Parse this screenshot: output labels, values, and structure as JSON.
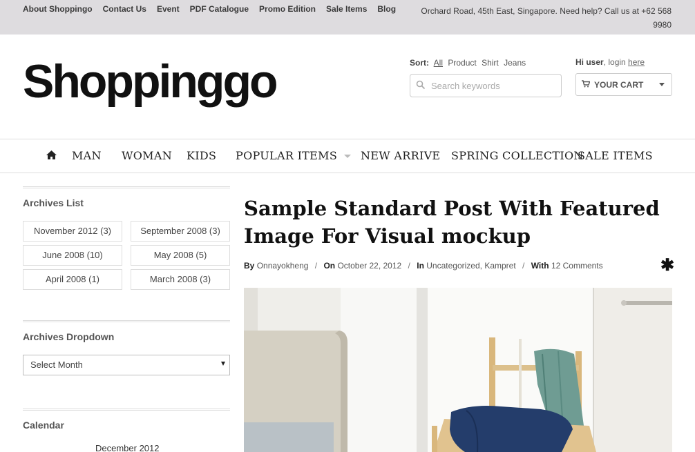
{
  "topbar": {
    "links": [
      "About Shoppingo",
      "Contact Us",
      "Event",
      "PDF Catalogue",
      "Promo Edition",
      "Sale Items",
      "Blog"
    ],
    "info": "Orchard Road, 45th East, Singapore. Need help? Call us at +62 568 9980"
  },
  "header": {
    "logo": "Shoppinggo",
    "sort_label": "Sort:",
    "sort_options": [
      "All",
      "Product",
      "Shirt",
      "Jeans"
    ],
    "search_placeholder": "Search keywords",
    "greeting_bold": "Hi user",
    "greeting_text": ", login ",
    "greeting_link": "here",
    "cart_label": "YOUR CART"
  },
  "nav": {
    "items": [
      "MAN",
      "WOMAN",
      "KIDS",
      "POPULAR ITEMS",
      "NEW ARRIVE",
      "SPRING COLLECTION",
      "SALE ITEMS"
    ]
  },
  "sidebar": {
    "archives_title": "Archives List",
    "archives": [
      "November 2012 (3)",
      "September 2008 (3)",
      "June 2008 (10)",
      "May 2008 (5)",
      "April 2008 (1)",
      "March 2008 (3)"
    ],
    "dropdown_title": "Archives Dropdown",
    "dropdown_value": "Select Month",
    "calendar_title": "Calendar",
    "calendar_month": "December 2012"
  },
  "post": {
    "title": "Sample Standard Post With Featured Image For Visual mockup",
    "by_label": "By",
    "author": "Onnayokheng",
    "on_label": "On",
    "date": "October 22, 2012",
    "in_label": "In",
    "category1": "Uncategorized",
    "category2": "Kampret",
    "with_label": "With",
    "comments": "12 Comments"
  }
}
